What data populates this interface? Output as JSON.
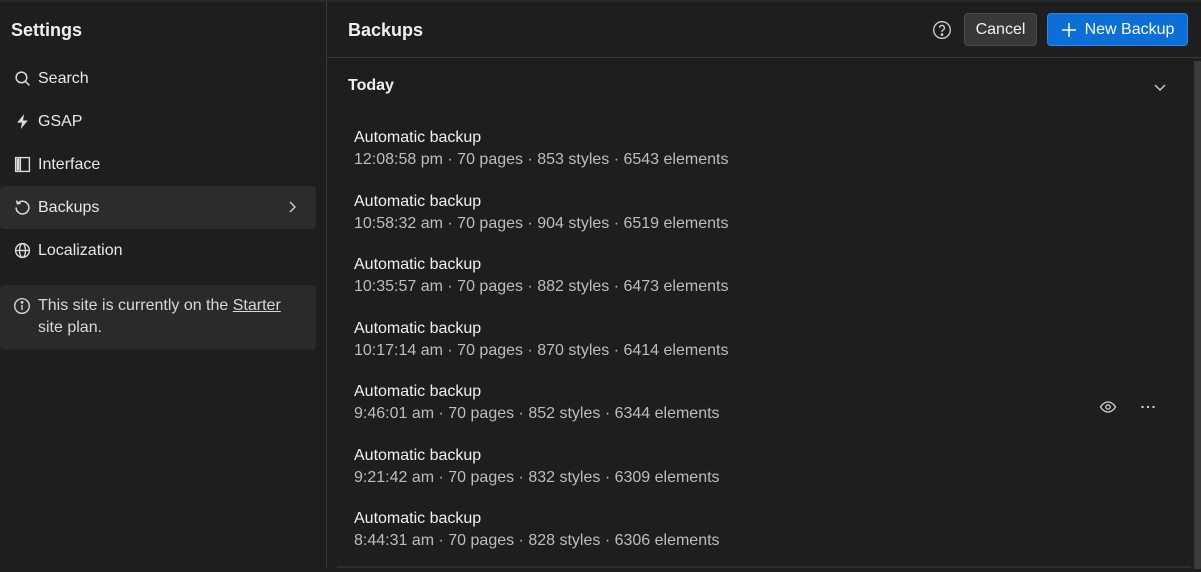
{
  "sidebar": {
    "title": "Settings",
    "items": [
      {
        "label": "Search",
        "icon": "search-icon"
      },
      {
        "label": "GSAP",
        "icon": "bolt-icon"
      },
      {
        "label": "Interface",
        "icon": "layout-icon"
      },
      {
        "label": "Backups",
        "icon": "restore-icon",
        "active": true
      },
      {
        "label": "Localization",
        "icon": "globe-icon"
      }
    ],
    "plan": {
      "prefix": "This site is currently on the ",
      "link": "Starter",
      "suffix": "site plan."
    }
  },
  "header": {
    "title": "Backups",
    "cancel_label": "Cancel",
    "new_label": "New Backup"
  },
  "group": {
    "title": "Today",
    "backups": [
      {
        "title": "Automatic backup",
        "meta": "12:08:58 pm · 70 pages · 853 styles · 6543 elements"
      },
      {
        "title": "Automatic backup",
        "meta": "10:58:32 am · 70 pages · 904 styles · 6519 elements"
      },
      {
        "title": "Automatic backup",
        "meta": "10:35:57 am · 70 pages · 882 styles · 6473 elements"
      },
      {
        "title": "Automatic backup",
        "meta": "10:17:14 am · 70 pages · 870 styles · 6414 elements"
      },
      {
        "title": "Automatic backup",
        "meta": "9:46:01 am · 70 pages · 852 styles · 6344 elements"
      },
      {
        "title": "Automatic backup",
        "meta": "9:21:42 am · 70 pages · 832 styles · 6309 elements"
      },
      {
        "title": "Automatic backup",
        "meta": "8:44:31 am · 70 pages · 828 styles · 6306 elements"
      }
    ]
  },
  "colors": {
    "background": "#1e1e1e",
    "accent": "#0b6fd8",
    "active_item": "#2c2c2c"
  }
}
